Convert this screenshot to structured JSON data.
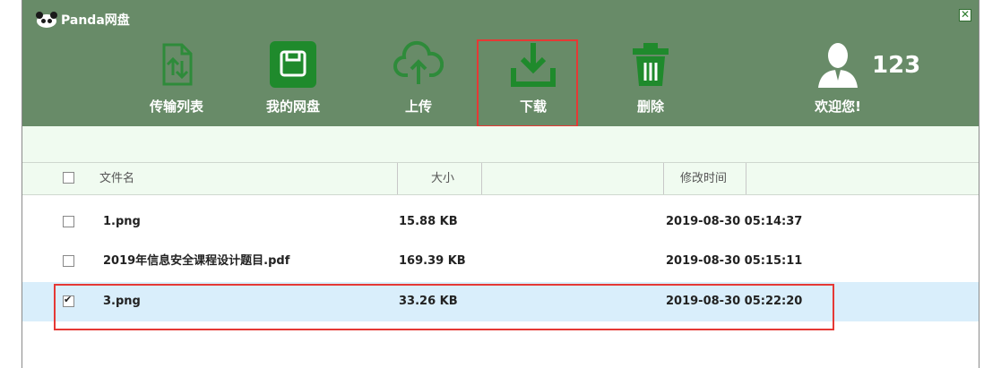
{
  "app": {
    "title": "Panda网盘"
  },
  "window": {
    "close": "✕"
  },
  "toolbar": {
    "transfer_list": "传输列表",
    "my_disk": "我的网盘",
    "upload": "上传",
    "download": "下载",
    "delete": "删除",
    "welcome": "欢迎您!",
    "user": "123"
  },
  "table": {
    "columns": {
      "name": "文件名",
      "size": "大小",
      "modified": "修改时间"
    },
    "rows": [
      {
        "name": "1.png",
        "size": "15.88 KB",
        "modified": "2019-08-30 05:14:37",
        "checked": false
      },
      {
        "name": "2019年信息安全课程设计题目.pdf",
        "size": "169.39 KB",
        "modified": "2019-08-30 05:15:11",
        "checked": false
      },
      {
        "name": "3.png",
        "size": "33.26 KB",
        "modified": "2019-08-30 05:22:20",
        "checked": true
      }
    ]
  },
  "colors": {
    "header": "#688b68",
    "accent": "#2e7d32",
    "highlight": "#e53935",
    "selected_row": "#d9eefb"
  }
}
